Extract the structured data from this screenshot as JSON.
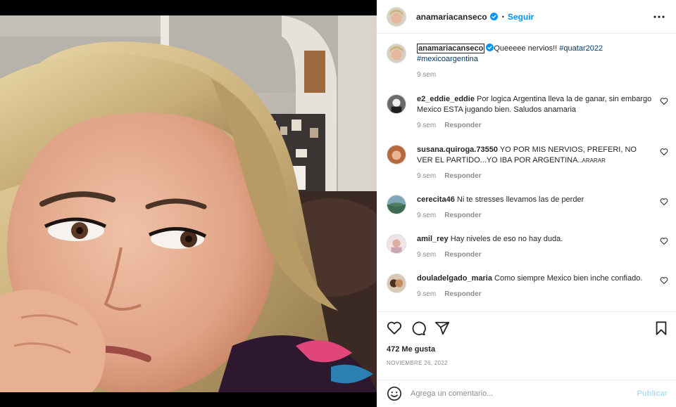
{
  "post": {
    "username": "anamariacanseco",
    "follow_label": "Seguir",
    "caption": "Queeeee nervios!! ",
    "hashtags": [
      "#quatar2022",
      "#mexicoargentina"
    ],
    "caption_time": "9 sem"
  },
  "comments": [
    {
      "username": "e2_eddie_eddie",
      "text": "Por logica Argentina lleva la de ganar, sin embargo Mexico ESTA jugando bien. Saludos anamaria",
      "small": "",
      "time": "9 sem",
      "reply": "Responder"
    },
    {
      "username": "susana.quiroga.73550",
      "text": "YO POR MIS NERVIOS, PREFERI, NO VER EL PARTIDO...YO IBA POR ARGENTINA..",
      "small": "ARARAR",
      "time": "9 sem",
      "reply": "Responder"
    },
    {
      "username": "cerecita46",
      "text": "Ni te stresses llevamos las de perder",
      "small": "",
      "time": "9 sem",
      "reply": "Responder"
    },
    {
      "username": "amil_rey",
      "text": "Hay niveles de eso no hay duda.",
      "small": "",
      "time": "9 sem",
      "reply": "Responder"
    },
    {
      "username": "douladelgado_maria",
      "text": "Como siempre Mexico bien inche confiado.",
      "small": "",
      "time": "9 sem",
      "reply": "Responder"
    }
  ],
  "actions": {
    "likes": "472 Me gusta",
    "date": "NOVIEMBRE 26, 2022"
  },
  "add_comment": {
    "placeholder": "Agrega un comentario...",
    "publish_label": "Publicar"
  },
  "colors": {
    "accent": "#0095f6",
    "publish_disabled": "#b2dffc",
    "hashtag": "#00376b",
    "muted": "#8e8e8e"
  },
  "icons": [
    "more-options-icon",
    "verified-badge-icon",
    "heart-icon",
    "comment-icon",
    "share-icon",
    "save-bookmark-icon",
    "emoji-icon"
  ]
}
